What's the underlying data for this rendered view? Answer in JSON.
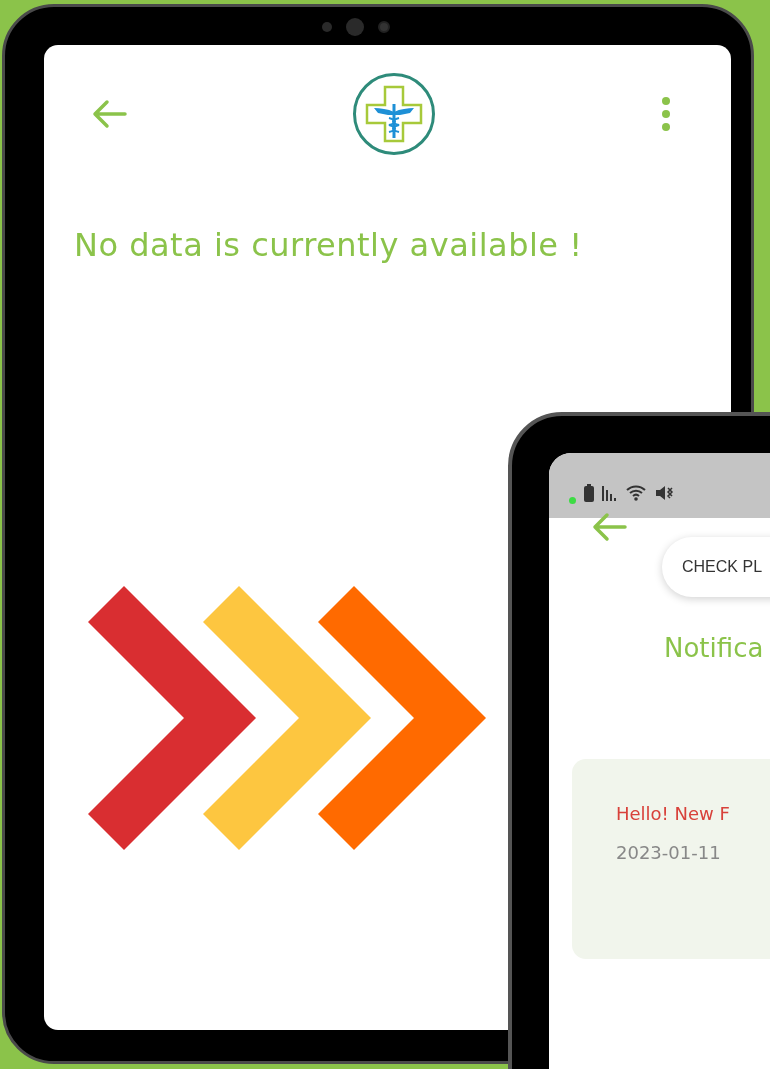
{
  "tablet": {
    "message": "No data is currently available !"
  },
  "phone": {
    "button": "CHECK PL",
    "heading": "Notifica",
    "notifications": [
      {
        "title": "Hello! New F",
        "time": "2023-01-11"
      }
    ]
  }
}
